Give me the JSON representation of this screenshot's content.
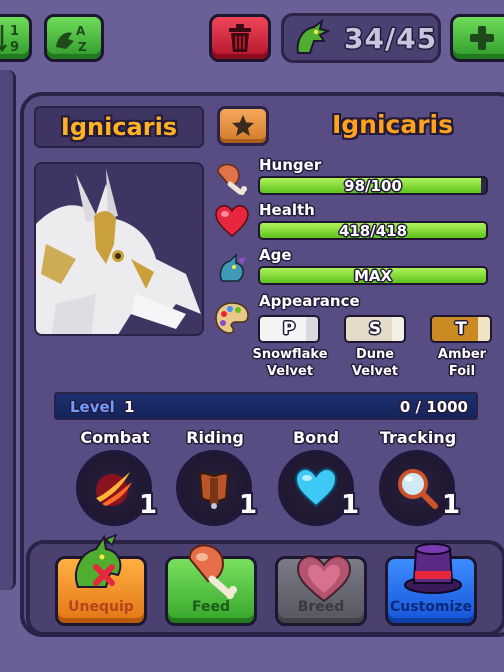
{
  "toolbar": {
    "sort_number_label": "1 9",
    "sort_alpha_label": "A Z",
    "inventory_count": "34/45"
  },
  "dragon": {
    "name": "Ignicaris",
    "species": "Ignicaris"
  },
  "stats": {
    "hunger": {
      "label": "Hunger",
      "value": "98/100",
      "fraction": 0.98
    },
    "health": {
      "label": "Health",
      "value": "418/418",
      "fraction": 1.0
    },
    "age": {
      "label": "Age",
      "value": "MAX",
      "fraction": 1.0
    },
    "appearance_label": "Appearance"
  },
  "appearance": [
    {
      "letter": "P",
      "name_line1": "Snowflake",
      "name_line2": "Velvet",
      "color": "#f4f4f6",
      "accent": "#d9d9de"
    },
    {
      "letter": "S",
      "name_line1": "Dune",
      "name_line2": "Velvet",
      "color": "#e4dcc8",
      "accent": "#f2efe6"
    },
    {
      "letter": "T",
      "name_line1": "Amber",
      "name_line2": "Foil",
      "color": "#c98b22",
      "accent": "#f1e3c4"
    }
  ],
  "level": {
    "label": "Level",
    "value": "1",
    "xp": "0 / 1000"
  },
  "skills": [
    {
      "name": "Combat",
      "level": "1",
      "icon": "combat-slash-icon"
    },
    {
      "name": "Riding",
      "level": "1",
      "icon": "saddle-icon"
    },
    {
      "name": "Bond",
      "level": "1",
      "icon": "heart-icon"
    },
    {
      "name": "Tracking",
      "level": "1",
      "icon": "magnifier-icon"
    }
  ],
  "actions": {
    "unequip": "Unequip",
    "feed": "Feed",
    "breed": "Breed",
    "customize": "Customize"
  },
  "colors": {
    "panel": "#584d82",
    "name_orange": "#ffa21c",
    "bar_green": "#7fd33a",
    "level_blue": "#1c2f70"
  }
}
